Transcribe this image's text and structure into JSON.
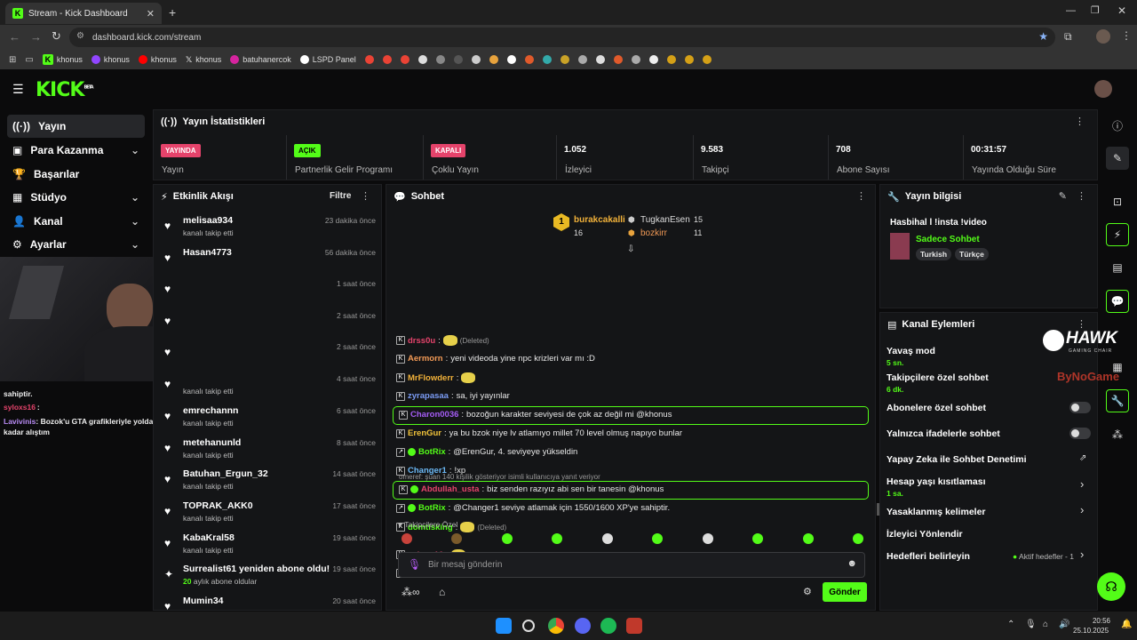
{
  "browser": {
    "tab_title": "Stream - Kick Dashboard",
    "url": "dashboard.kick.com/stream",
    "bookmarks": [
      "khonus",
      "khonus",
      "khonus",
      "khonus",
      "batuhanercok",
      "LSPD Panel"
    ]
  },
  "app": {
    "logo": "KICK",
    "logo_sup": "BETA"
  },
  "sidebar": {
    "items": [
      {
        "label": "Yayın",
        "icon": "broadcast-icon"
      },
      {
        "label": "Para Kazanma",
        "icon": "money-icon"
      },
      {
        "label": "Başarılar",
        "icon": "trophy-icon"
      },
      {
        "label": "Stüdyo",
        "icon": "studio-icon"
      },
      {
        "label": "Kanal",
        "icon": "channel-icon"
      },
      {
        "label": "Ayarlar",
        "icon": "gear-icon"
      }
    ]
  },
  "overlay_chat": [
    {
      "user": "",
      "text": "sahiptir."
    },
    {
      "user": "syloxs16",
      "text": ":"
    },
    {
      "user": "Lavivinis",
      "text": ": Bozok'u GTA grafikleriyle yolda görsem yadırgamam o kadar alıştım"
    }
  ],
  "stats": {
    "title": "Yayın İstatistikleri",
    "items": [
      {
        "badge": "YAYINDA",
        "label": "Yayın"
      },
      {
        "badge": "AÇIK",
        "label": "Partnerlik Gelir Programı"
      },
      {
        "badge": "KAPALI",
        "label": "Çoklu Yayın"
      },
      {
        "value": "1.052",
        "label": "İzleyici"
      },
      {
        "value": "9.583",
        "label": "Takipçi"
      },
      {
        "value": "708",
        "label": "Abone Sayısı"
      },
      {
        "value": "00:31:57",
        "label": "Yayında Olduğu Süre"
      }
    ]
  },
  "activity": {
    "title": "Etkinlik Akışı",
    "filter": "Filtre",
    "events": [
      {
        "name": "melisaa934",
        "sub": "kanalı takip etti",
        "time": "23 dakika önce"
      },
      {
        "name": "Hasan4773",
        "sub": "",
        "time": "56 dakika önce"
      },
      {
        "name": "",
        "sub": "",
        "time": "1 saat önce"
      },
      {
        "name": "",
        "sub": "",
        "time": "2 saat önce"
      },
      {
        "name": "",
        "sub": "",
        "time": "2 saat önce"
      },
      {
        "name": "",
        "sub": "kanalı takip etti",
        "time": "4 saat önce"
      },
      {
        "name": "emrechannn",
        "sub": "kanalı takip etti",
        "time": "6 saat önce"
      },
      {
        "name": "metehanunld",
        "sub": "kanalı takip etti",
        "time": "8 saat önce"
      },
      {
        "name": "Batuhan_Ergun_32",
        "sub": "kanalı takip etti",
        "time": "14 saat önce"
      },
      {
        "name": "TOPRAK_AKK0",
        "sub": "kanalı takip etti",
        "time": "17 saat önce"
      },
      {
        "name": "KabaKral58",
        "sub": "kanalı takip etti",
        "time": "19 saat önce"
      },
      {
        "name": "Surrealist61 yeniden abone oldu!",
        "sub_count": "20",
        "sub": "aylık abone oldular",
        "time": "19 saat önce"
      },
      {
        "name": "Mumin34",
        "sub": "",
        "time": "20 saat önce"
      }
    ]
  },
  "chat": {
    "title": "Sohbet",
    "leaderboard": [
      {
        "name": "burakcakalli",
        "count": "16"
      },
      {
        "name": "TugkanEsen",
        "count": "15"
      },
      {
        "name": "bozkirr",
        "count": "11"
      }
    ],
    "messages": [
      {
        "user": "drss0u",
        "text": "(Deleted)",
        "color": "#e5436b",
        "emote": true
      },
      {
        "user": "Aermorn",
        "text": "yeni videoda yine npc krizleri var mı :D",
        "color": "#f29a56"
      },
      {
        "user": "MrFlowderr",
        "text": "",
        "color": "#f2b23a",
        "emote": true
      },
      {
        "user": "zyrapasaa",
        "text": "sa, iyi yayınlar",
        "color": "#7b9cf5"
      },
      {
        "user": "Charon0036",
        "text": "bozoğun karakter seviyesi de çok az değil mi @khonus",
        "color": "#a55cf5",
        "highlight": true
      },
      {
        "user": "ErenGur",
        "text": "ya bu bzok niye lv atlamıyo millet 70 level olmuş napıyo bunlar",
        "color": "#f0c23a"
      },
      {
        "user": "BotRix",
        "text": "@ErenGur, 4. seviyeye yükseldin",
        "color": "#53fc18"
      },
      {
        "user": "Changer1",
        "text": "!xp",
        "color": "#6bb8f5"
      },
      {
        "user": "Abdullah_usta",
        "text": "biz senden razıyız abi sen bir tanesin @khonus",
        "color": "#e5436b",
        "highlight": true
      },
      {
        "user": "BotRix",
        "text": "@Changer1 seviye atlamak için 1550/1600 XP'ye sahiptir.",
        "color": "#53fc18"
      },
      {
        "user": "domtisking",
        "text": "(Deleted)",
        "color": "#53fc18",
        "emote": true
      },
      {
        "user": "syloxs16",
        "text": "",
        "color": "#e5436b",
        "emote": true
      },
      {
        "user": "Lavivinis",
        "text": "Bozok'u GTA grafikleriyle yolda görsem yadırgamam o kadar alıştım",
        "color": "#b98cf5"
      }
    ],
    "reply_note": "omeref: şuan 140 kişilik gösteriyor isimli kullanıcıya yanıt veriyor",
    "followers_only": "Takipçilere Özel",
    "input_placeholder": "Bir mesaj gönderin",
    "send": "Gönder"
  },
  "stream_info": {
    "title": "Yayın bilgisi",
    "stream_title": "Hasbihal l !insta !video",
    "category": "Sadece Sohbet",
    "tags": [
      "Turkish",
      "Türkçe"
    ]
  },
  "channel_actions": {
    "title": "Kanal Eylemleri",
    "rows": [
      {
        "label": "Yavaş mod",
        "sub": "5 sn."
      },
      {
        "label": "Takipçilere özel sohbet",
        "sub": "6 dk."
      },
      {
        "label": "Abonelere özel sohbet",
        "toggle": true
      },
      {
        "label": "Yalnızca ifadelerle sohbet",
        "toggle": true
      },
      {
        "label": "Yapay Zeka ile Sohbet Denetimi"
      },
      {
        "label": "Hesap yaşı kısıtlaması",
        "sub": "1 sa."
      },
      {
        "label": "Yasaklanmış kelimeler"
      },
      {
        "label": "İzleyici Yönlendir"
      },
      {
        "label": "Hedefleri belirleyin",
        "extra": "Aktif hedefler - 1"
      }
    ]
  },
  "overlay_brand": {
    "name": "HAWK",
    "sub": "GAMING CHAIR",
    "sponsor": "ByNoGame"
  },
  "taskbar": {
    "time": "20:56",
    "date": "25.10.2025"
  },
  "colors": {
    "accent": "#53fc18",
    "live": "#e5436b",
    "bg": "#0b0b0c",
    "panel": "#141517"
  }
}
